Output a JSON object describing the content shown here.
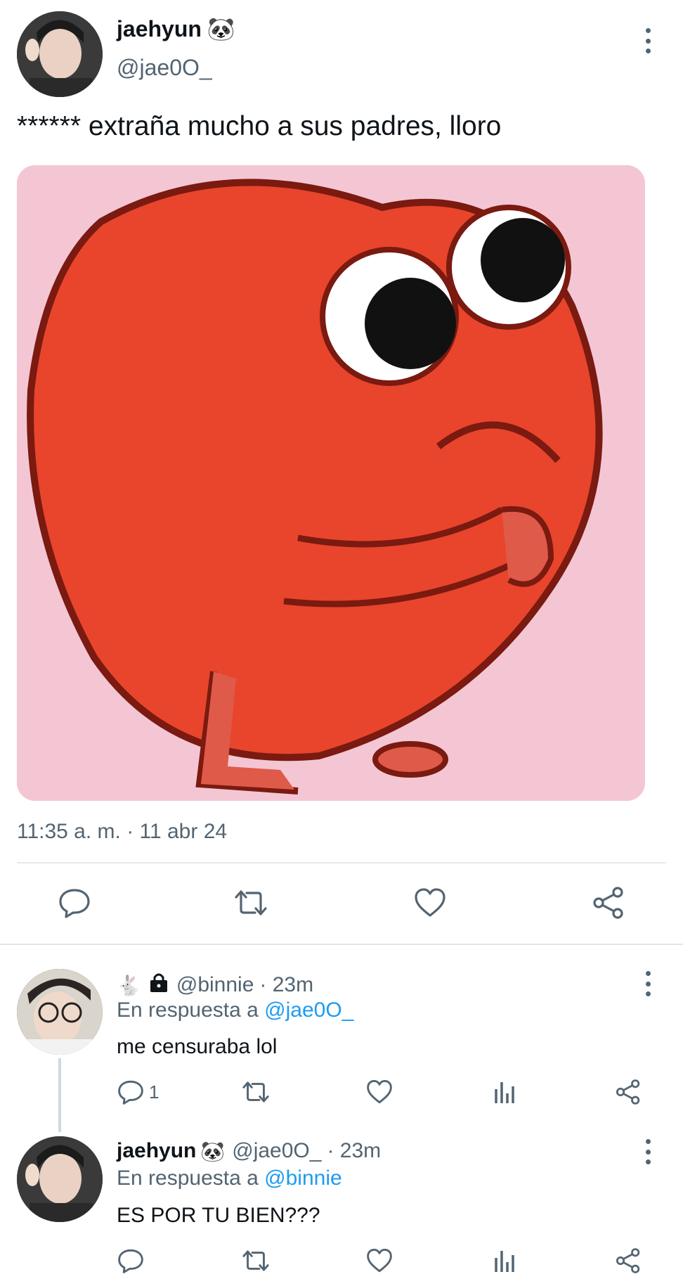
{
  "tweet": {
    "author_name": "jaehyun",
    "author_emoji": "🐼",
    "author_handle": "@jae0O_",
    "text": "****** extraña mucho a sus padres, lloro",
    "timestamp": "11:35 a. m. · 11 abr 24",
    "media_description_icon": "crying-heart-meme",
    "actions": [
      "reply-icon",
      "retweet-icon",
      "like-icon",
      "share-icon"
    ]
  },
  "replies": [
    {
      "author_name": "",
      "author_emoji": "🐇",
      "lock_icon": "lock-icon",
      "author_handle": "@binnie",
      "time": "· 23m",
      "in_reply_prefix": "En respuesta a",
      "in_reply_to": "@jae0O_",
      "text": "me censuraba lol",
      "reply_count": "1"
    },
    {
      "author_name": "jaehyun",
      "author_emoji": "🐼",
      "author_handle": "@jae0O_",
      "time": "· 23m",
      "in_reply_prefix": "En respuesta a",
      "in_reply_to": "@binnie",
      "text": "ES POR TU BIEN???"
    }
  ],
  "colors": {
    "link": "#1d9bf0",
    "secondary": "#536471",
    "media_bg": "#f4c6d4",
    "heart": "#e8452c"
  }
}
